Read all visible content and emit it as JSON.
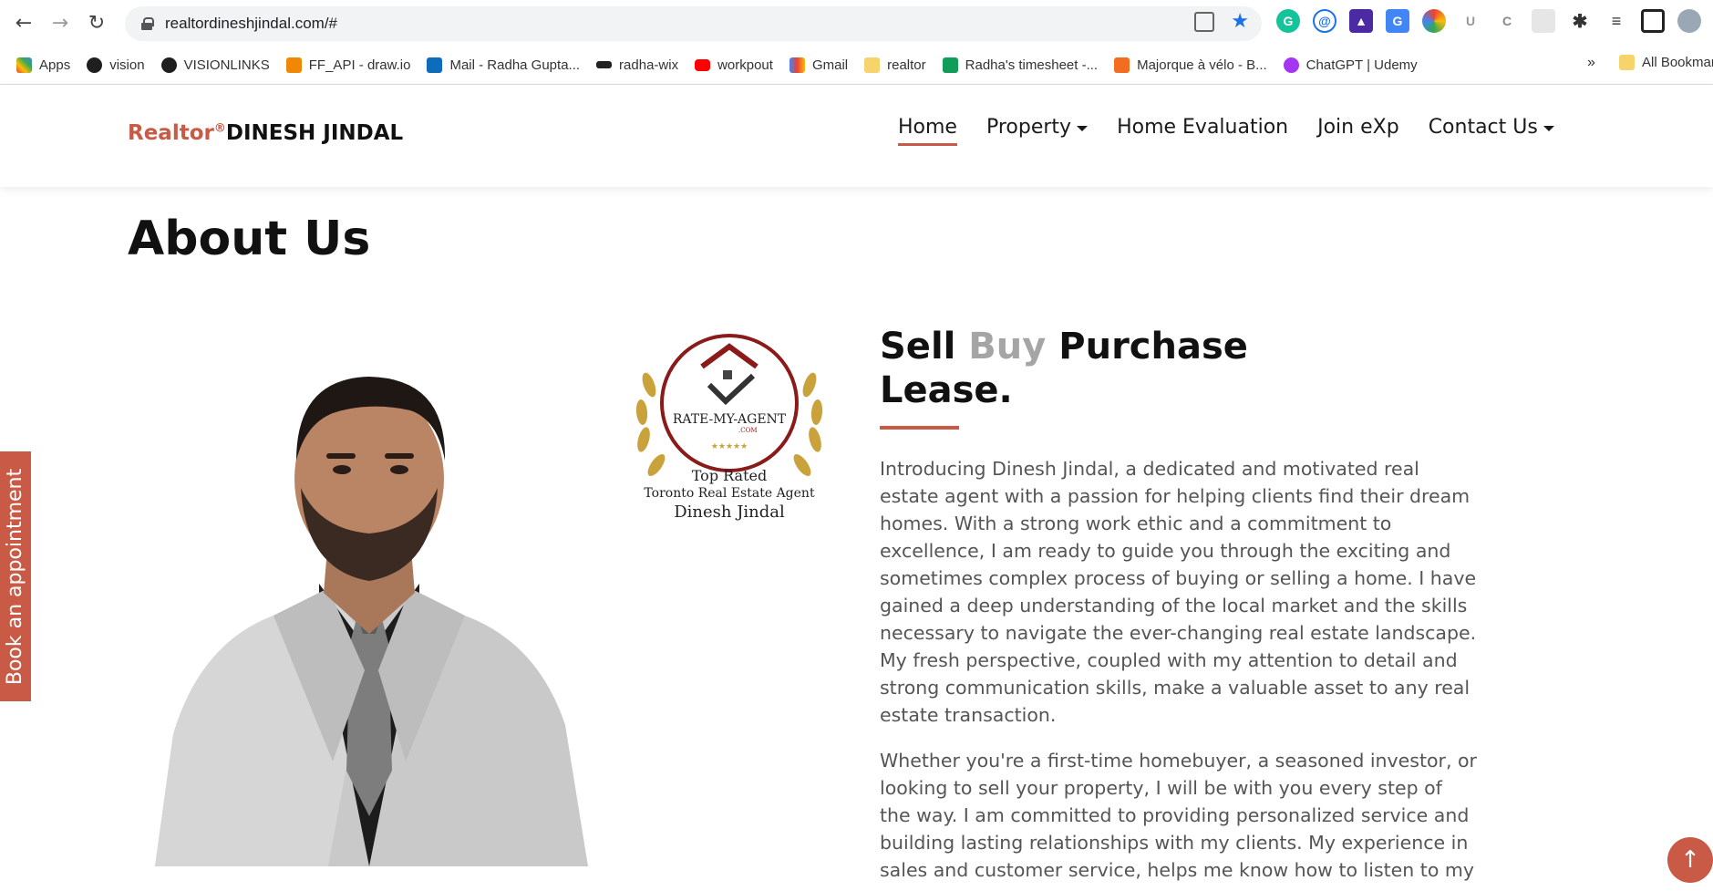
{
  "browser": {
    "url": "realtordineshjindal.com/#",
    "bookmarks": [
      {
        "label": "Apps",
        "color": "#ea4335"
      },
      {
        "label": "vision",
        "color": "#1f1f1f"
      },
      {
        "label": "VISIONLINKS",
        "color": "#1f1f1f"
      },
      {
        "label": "FF_API - draw.io",
        "color": "#f08705"
      },
      {
        "label": "Mail - Radha Gupta...",
        "color": "#0f6cbd"
      },
      {
        "label": "radha-wix",
        "color": "#222222"
      },
      {
        "label": "workpout",
        "color": "#ff0000"
      },
      {
        "label": "Gmail",
        "color": "#ea4335"
      },
      {
        "label": "realtor",
        "color": "#f6d36b"
      },
      {
        "label": "Radha's timesheet -...",
        "color": "#0f9d58"
      },
      {
        "label": "Majorque à vélo - B...",
        "color": "#f36d21"
      },
      {
        "label": "ChatGPT | Udemy",
        "color": "#a435f0"
      }
    ],
    "more_label": "»",
    "all_bookmarks_label": "All Bookmarks"
  },
  "site": {
    "brand": {
      "realtor": "Realtor",
      "reg": "®",
      "name": "DINESH JINDAL"
    },
    "nav": [
      {
        "label": "Home",
        "active": true,
        "dropdown": false
      },
      {
        "label": "Property",
        "active": false,
        "dropdown": true
      },
      {
        "label": "Home Evaluation",
        "active": false,
        "dropdown": false
      },
      {
        "label": "Join eXp",
        "active": false,
        "dropdown": false
      },
      {
        "label": "Contact Us",
        "active": false,
        "dropdown": true
      }
    ],
    "accent_color": "#c85a46"
  },
  "about": {
    "title": "About Us",
    "headline": {
      "w1": "Sell",
      "w2": "Buy",
      "w3": "Purchase",
      "w4": "Lease."
    },
    "badge": {
      "logo": "RATE-MY-AGENT",
      "logo_sub": ".COM",
      "stars": "★★★★★",
      "line1": "Top Rated",
      "line2": "Toronto Real Estate Agent",
      "line3": "Dinesh Jindal"
    },
    "paragraphs": [
      "Introducing Dinesh Jindal, a dedicated and motivated real estate agent with a passion for helping clients find their dream homes. With a strong work ethic and a commitment to excellence, I am ready to guide you through the exciting and sometimes complex process of buying or selling a home. I have gained a deep understanding of the local market and the skills necessary to navigate the ever-changing real estate landscape. My fresh perspective, coupled with my attention to detail and strong communication skills, make a valuable asset to any real estate transaction.",
      "Whether you're a first-time homebuyer, a seasoned investor, or looking to sell your property, I will be with you every step of the way. I am committed to providing personalized service and building lasting relationships with my clients. My experience in sales and customer service, helps me know how to listen to my"
    ]
  },
  "side_tab": {
    "label": "Book an appointment"
  },
  "scroll_top": {
    "icon": "↑"
  }
}
